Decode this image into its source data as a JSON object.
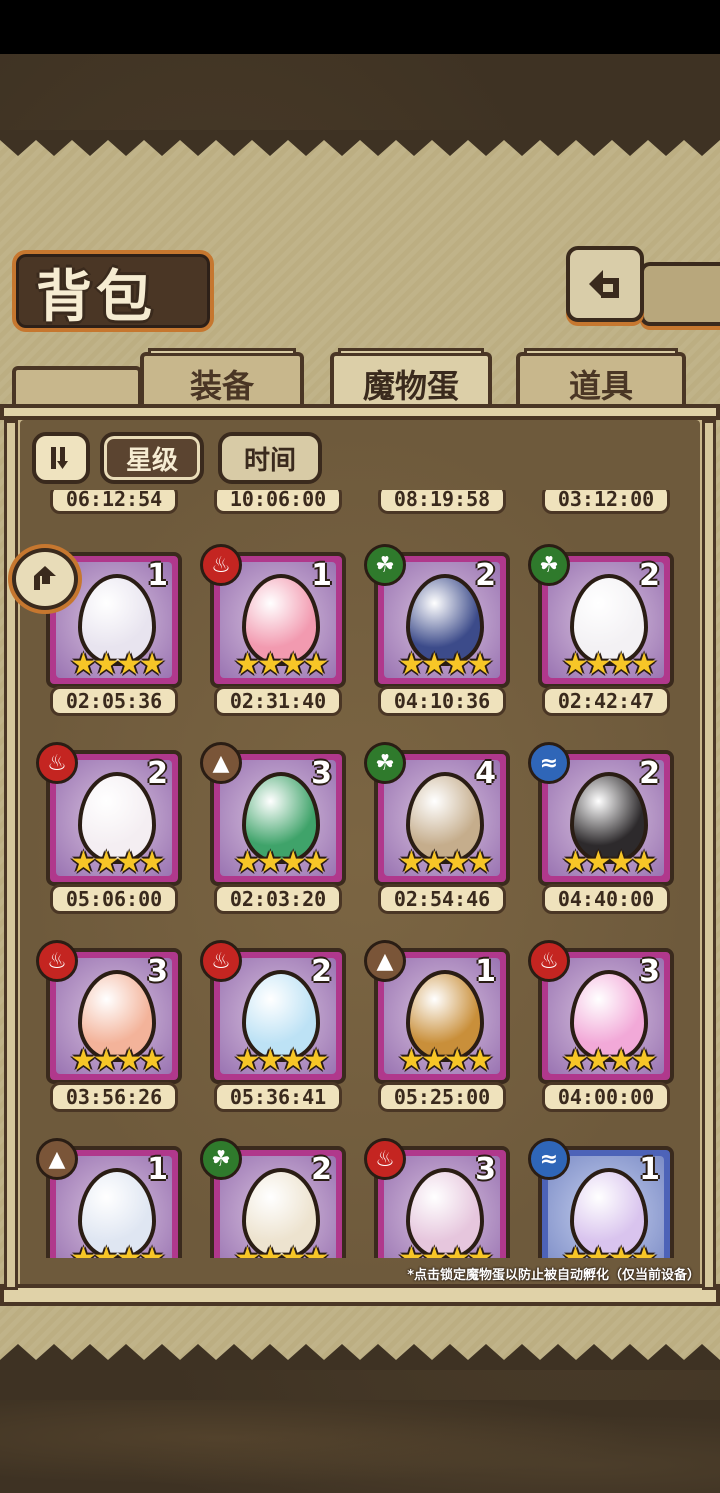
{
  "title": "背包",
  "tabs": [
    {
      "label": "装备",
      "active": false
    },
    {
      "label": "魔物蛋",
      "active": true
    },
    {
      "label": "道具",
      "active": false
    }
  ],
  "sort": {
    "toggle_icon": "sort-direction-icon",
    "options": [
      {
        "label": "星级",
        "active": true
      },
      {
        "label": "时间",
        "active": false
      }
    ]
  },
  "top_timers": [
    "06:12:54",
    "10:06:00",
    "08:19:58",
    "03:12:00"
  ],
  "eggs": [
    {
      "element": "none",
      "element_icon": "",
      "count": "1",
      "stars": 4,
      "timer": "02:05:36",
      "egg_color": "#e8e4ef",
      "frame": "pink"
    },
    {
      "element": "fire",
      "element_icon": "fire-icon",
      "count": "1",
      "stars": 4,
      "timer": "02:31:40",
      "egg_color": "#f29ab0",
      "frame": "pink"
    },
    {
      "element": "leaf",
      "element_icon": "leaf-icon",
      "count": "2",
      "stars": 4,
      "timer": "04:10:36",
      "egg_color": "#3c4b8a",
      "frame": "pink"
    },
    {
      "element": "leaf",
      "element_icon": "leaf-icon",
      "count": "2",
      "stars": 4,
      "timer": "02:42:47",
      "egg_color": "#f3f1f4",
      "frame": "pink"
    },
    {
      "element": "fire",
      "element_icon": "fire-icon",
      "count": "2",
      "stars": 4,
      "timer": "05:06:00",
      "egg_color": "#f4eef2",
      "frame": "pink"
    },
    {
      "element": "earth",
      "element_icon": "mountain-icon",
      "count": "3",
      "stars": 4,
      "timer": "02:03:20",
      "egg_color": "#3fa36a",
      "frame": "pink"
    },
    {
      "element": "leaf",
      "element_icon": "leaf-icon",
      "count": "4",
      "stars": 4,
      "timer": "02:54:46",
      "egg_color": "#c5ad8c",
      "frame": "pink"
    },
    {
      "element": "water",
      "element_icon": "water-icon",
      "count": "2",
      "stars": 4,
      "timer": "04:40:00",
      "egg_color": "#2d2a2c",
      "frame": "pink"
    },
    {
      "element": "fire",
      "element_icon": "fire-icon",
      "count": "3",
      "stars": 4,
      "timer": "03:56:26",
      "egg_color": "#f3b39a",
      "frame": "pink"
    },
    {
      "element": "fire",
      "element_icon": "fire-icon",
      "count": "2",
      "stars": 4,
      "timer": "05:36:41",
      "egg_color": "#bde2f5",
      "frame": "pink"
    },
    {
      "element": "earth",
      "element_icon": "mountain-icon",
      "count": "1",
      "stars": 4,
      "timer": "05:25:00",
      "egg_color": "#c98f3a",
      "frame": "pink"
    },
    {
      "element": "fire",
      "element_icon": "fire-icon",
      "count": "3",
      "stars": 4,
      "timer": "04:00:00",
      "egg_color": "#f2a9d8",
      "frame": "pink"
    },
    {
      "element": "earth",
      "element_icon": "mountain-icon",
      "count": "1",
      "stars": 4,
      "timer": "",
      "egg_color": "#dfe6f2",
      "frame": "pink"
    },
    {
      "element": "leaf",
      "element_icon": "leaf-icon",
      "count": "2",
      "stars": 4,
      "timer": "",
      "egg_color": "#ede3cf",
      "frame": "pink"
    },
    {
      "element": "fire",
      "element_icon": "fire-icon",
      "count": "3",
      "stars": 4,
      "timer": "",
      "egg_color": "#e6c6dd",
      "frame": "pink"
    },
    {
      "element": "water",
      "element_icon": "water-icon",
      "count": "1",
      "stars": 4,
      "timer": "",
      "egg_color": "#d9c4ee",
      "frame": "blue"
    }
  ],
  "footnote": "*点击锁定魔物蛋以防止被自动孵化（仅当前设备）",
  "colors": {
    "parchment": "#bcae82",
    "frame_brown": "#4a3625",
    "accent_orange": "#c6772f",
    "star_gold": "#f7c627"
  }
}
